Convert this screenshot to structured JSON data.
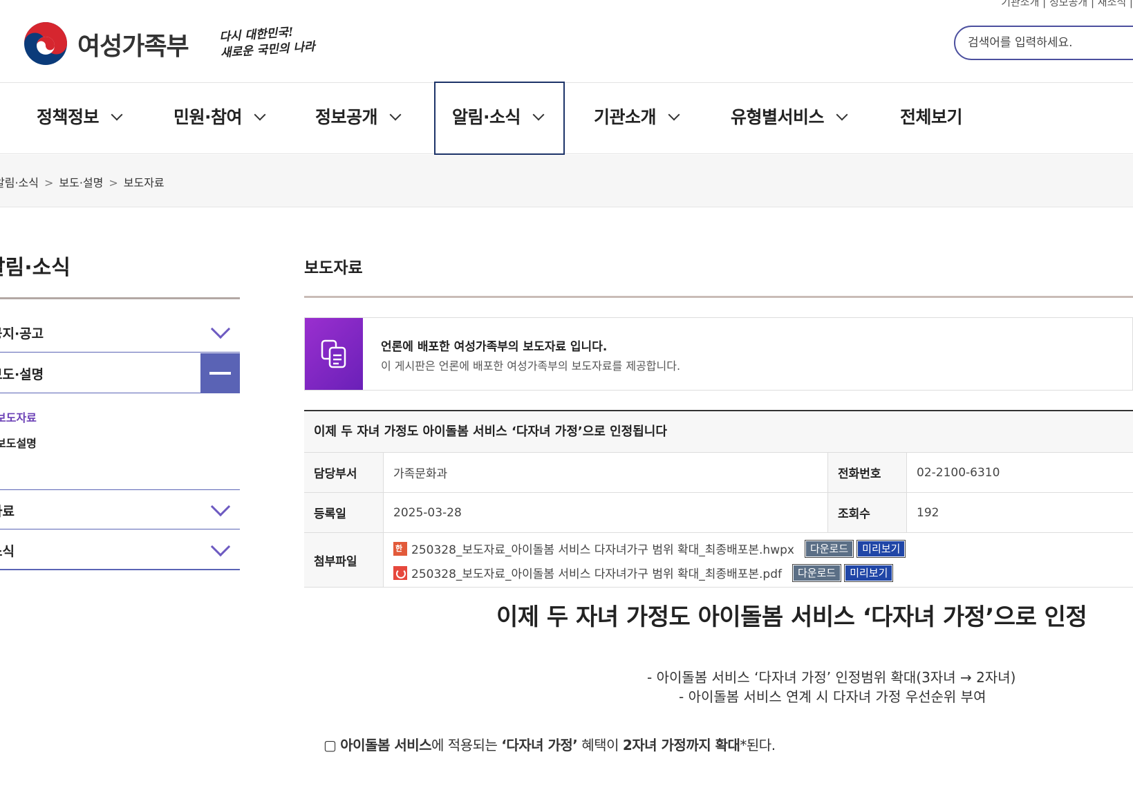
{
  "header": {
    "top_util": "기관소개 | 정보공개 | 새소식 |",
    "logo_text": "여성가족부",
    "slogan_line1": "다시 대한민국!",
    "slogan_line2": "새로운 국민의 나라",
    "search_placeholder": "검색어를 입력하세요."
  },
  "gnb": [
    {
      "label": "정책정보"
    },
    {
      "label": "민원·참여"
    },
    {
      "label": "정보공개"
    },
    {
      "label": "알림·소식"
    },
    {
      "label": "기관소개"
    },
    {
      "label": "유형별서비스"
    },
    {
      "label": "전체보기"
    }
  ],
  "breadcrumb": [
    "알림·소식",
    "보도·설명",
    "보도자료"
  ],
  "lnb": {
    "title": "알림·소식",
    "items": [
      {
        "label": "공지·공고"
      },
      {
        "label": "보도·설명"
      },
      {
        "label": "보도자료"
      },
      {
        "label": "보도설명"
      },
      {
        "label": "자료"
      },
      {
        "label": "소식"
      }
    ],
    "active_color": "#6a3fb5",
    "accent": "#5a63b5"
  },
  "content": {
    "title": "보도자료",
    "info_strong": "언론에 배포한 여성가족부의 보도자료 입니다.",
    "info_desc": "이 게시판은 언론에 배포한 여성가족부의 보도자료를 제공합니다.",
    "view": {
      "title": "이제 두 자녀 가정도 아이돌봄 서비스 ‘다자녀 가정’으로 인정됩니다",
      "dept_label": "담당부서",
      "dept": "가족문화과",
      "phone_label": "전화번호",
      "phone": "02-2100-6310",
      "date_label": "등록일",
      "date": "2025-03-28",
      "views_label": "조회수",
      "views": "192",
      "files_label": "첨부파일",
      "files": [
        {
          "name": "250328_보도자료_아이돌봄 서비스 다자녀가구 범위 확대_최종배포본.hwpx",
          "type": "hwp"
        },
        {
          "name": "250328_보도자료_아이돌봄 서비스 다자녀가구 범위 확대_최종배포본.pdf",
          "type": "pdf"
        }
      ],
      "download_label": "다운로드",
      "preview_label": "미리보기"
    }
  },
  "article": {
    "headline": "이제 두 자녀 가정도 아이돌봄 서비스 ‘다자녀 가정’으로 인정",
    "sub1": "- 아이돌봄 서비스 ‘다자녀 가정’ 인정범위 확대(3자녀 → 2자녀)",
    "sub2": "- 아이돌봄 서비스 연계 시 다자녀 가정 우선순위 부여",
    "para_box": "▢ ",
    "para_b1": "아이돌봄 서비스",
    "para_t1": "에 적용되는 ",
    "para_b2": "‘다자녀 가정’",
    "para_t2": " 혜택이 ",
    "para_b3": "2자녀 가정까지 확대",
    "para_t3": "*된다."
  }
}
